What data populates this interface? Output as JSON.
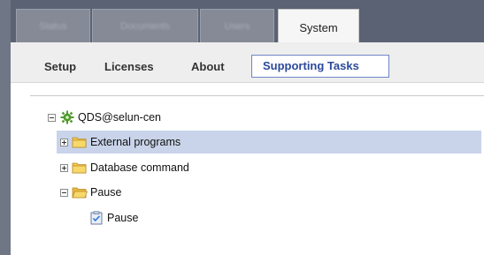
{
  "tabs": [
    {
      "label": "Status",
      "active": false
    },
    {
      "label": "Documents",
      "active": false
    },
    {
      "label": "Users",
      "active": false
    },
    {
      "label": "System",
      "active": true
    }
  ],
  "subtabs": [
    {
      "label": "Setup",
      "active": false
    },
    {
      "label": "Licenses",
      "active": false
    },
    {
      "label": "About",
      "active": false
    },
    {
      "label": "Supporting Tasks",
      "active": true
    }
  ],
  "tree": {
    "root": {
      "label": "QDS@selun-cen",
      "icon": "gear-icon",
      "expanded": true
    },
    "nodes": [
      {
        "label": "External programs",
        "icon": "folder-icon",
        "expanded": false,
        "selected": true
      },
      {
        "label": "Database command",
        "icon": "folder-icon",
        "expanded": false,
        "selected": false
      },
      {
        "label": "Pause",
        "icon": "folder-open-icon",
        "expanded": true,
        "selected": false,
        "children": [
          {
            "label": "Pause",
            "icon": "task-icon"
          }
        ]
      }
    ]
  },
  "colors": {
    "accent": "#2c4a9a",
    "selection": "#c9d4ea",
    "header": "#5b6274"
  }
}
